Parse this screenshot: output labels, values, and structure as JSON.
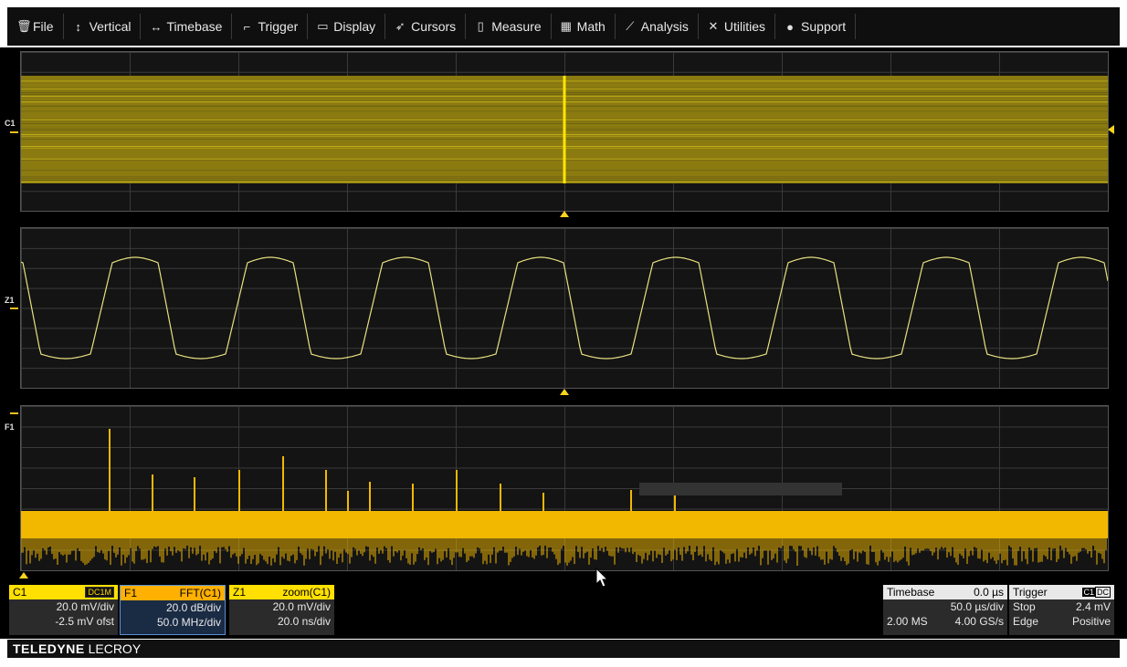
{
  "menu": [
    {
      "icon": "trash-icon",
      "glyph": "🗑",
      "label": "File"
    },
    {
      "icon": "vertical-arrows-icon",
      "glyph": "↕",
      "label": "Vertical"
    },
    {
      "icon": "horizontal-arrows-icon",
      "glyph": "↔",
      "label": "Timebase"
    },
    {
      "icon": "trigger-flag-icon",
      "glyph": "⌐",
      "label": "Trigger"
    },
    {
      "icon": "display-icon",
      "glyph": "▭",
      "label": "Display"
    },
    {
      "icon": "cursor-pointer-icon",
      "glyph": "➶",
      "label": "Cursors"
    },
    {
      "icon": "measure-icon",
      "glyph": "▯",
      "label": "Measure"
    },
    {
      "icon": "calculator-icon",
      "glyph": "▦",
      "label": "Math"
    },
    {
      "icon": "line-chart-icon",
      "glyph": "⟋",
      "label": "Analysis"
    },
    {
      "icon": "tools-icon",
      "glyph": "✕",
      "label": "Utilities"
    },
    {
      "icon": "info-icon",
      "glyph": "●",
      "label": "Support"
    }
  ],
  "traces": {
    "c1_label": "C1",
    "z1_label": "Z1",
    "f1_label": "F1",
    "color": "#f0d000"
  },
  "channels": {
    "c1": {
      "name": "C1",
      "coupling": "DC1M",
      "vdiv": "20.0 mV/div",
      "offset": "-2.5 mV ofst",
      "color": "#ffe000"
    },
    "f1": {
      "name": "F1",
      "func": "FFT(C1)",
      "vdiv": "20.0 dB/div",
      "hdiv": "50.0 MHz/div",
      "color": "#ffb000"
    },
    "z1": {
      "name": "Z1",
      "func": "zoom(C1)",
      "vdiv": "20.0 mV/div",
      "hdiv": "20.0 ns/div",
      "color": "#ffe000"
    }
  },
  "timebase": {
    "title": "Timebase",
    "delay": "0.0 µs",
    "per_div": "50.0 µs/div",
    "samples": "2.00 MS",
    "rate": "4.00 GS/s"
  },
  "trigger": {
    "title": "Trigger",
    "source": "C1",
    "coupling": "DC",
    "mode": "Stop",
    "level": "2.4 mV",
    "type": "Edge",
    "slope": "Positive"
  },
  "brand": {
    "bold": "TELEDYNE",
    "normal": "LECROY"
  }
}
